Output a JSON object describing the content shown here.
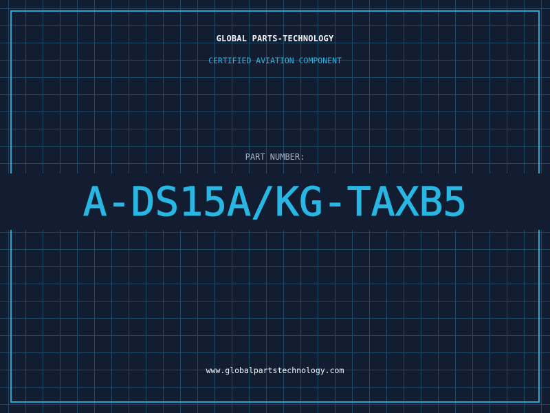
{
  "header": {
    "company_name": "GLOBAL PARTS-TECHNOLOGY",
    "tagline": "CERTIFIED AVIATION COMPONENT"
  },
  "part": {
    "label": "PART NUMBER:",
    "number": "A-DS15A/KG-TAXB5"
  },
  "footer": {
    "website": "www.globalpartstechnology.com"
  },
  "colors": {
    "background": "#121d32",
    "grid": "#1f4a63",
    "accent": "#28b6e2",
    "text": "#eef3f7"
  }
}
